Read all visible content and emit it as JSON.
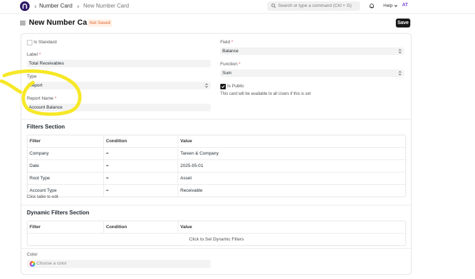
{
  "navbar": {
    "breadcrumbs": [
      "Number Card",
      "New Number Card"
    ],
    "search_placeholder": "Search or type a command (Ctrl + G)",
    "help_label": "Help",
    "avatar_initials": "AT"
  },
  "header": {
    "title": "New Number Card",
    "status": "Not Saved",
    "save_label": "Save"
  },
  "form": {
    "is_standard_label": "Is Standard",
    "is_standard": false,
    "label_label": "Label",
    "label_value": "Total Receivables",
    "type_label": "Type",
    "type_value": "Report",
    "report_name_label": "Report Name",
    "report_name_value": "Account Balance",
    "field_label": "Field",
    "field_value": "Balance",
    "function_label": "Function",
    "function_value": "Sum",
    "is_public_label": "Is Public",
    "is_public": true,
    "is_public_help": "This card will be available to all Users if this is set"
  },
  "filters_section": {
    "title": "Filters Section",
    "columns": [
      "Filter",
      "Condition",
      "Value"
    ],
    "rows": [
      {
        "filter": "Company",
        "condition": "=",
        "value": "Tareen & Company"
      },
      {
        "filter": "Date",
        "condition": "=",
        "value": "2025-05-01"
      },
      {
        "filter": "Root Type",
        "condition": "=",
        "value": "Asset"
      },
      {
        "filter": "Account Type",
        "condition": "=",
        "value": "Receivable"
      }
    ],
    "hint": "Click table to edit"
  },
  "dynamic_filters_section": {
    "title": "Dynamic Filters Section",
    "columns": [
      "Filter",
      "Condition",
      "Value"
    ],
    "empty_text": "Click to Set Dynamic Filters"
  },
  "color": {
    "label": "Color",
    "placeholder": "Choose a color"
  },
  "colors": {
    "brand": "#2e1a68",
    "highlight": "#f5e71c",
    "status": "#e0642b"
  }
}
